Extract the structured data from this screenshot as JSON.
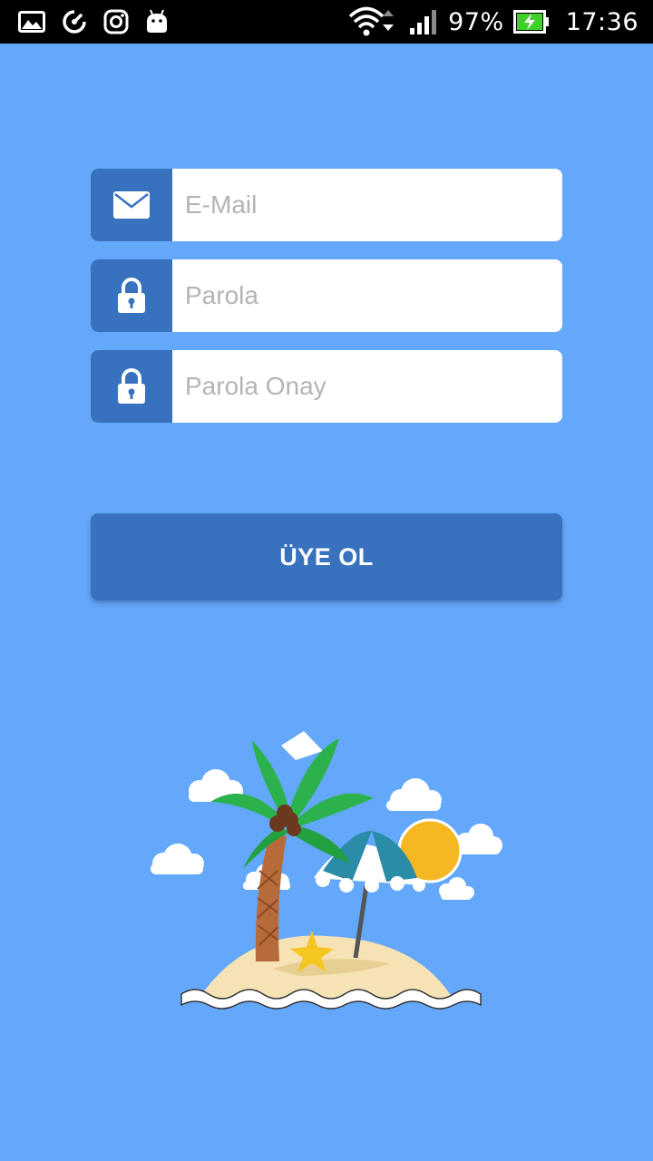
{
  "status_bar": {
    "battery_percent": "97%",
    "time": "17:36",
    "icons": [
      "gallery-icon",
      "speed-icon",
      "instagram-icon",
      "android-icon",
      "wifi-icon",
      "signal-icon",
      "battery-charging-icon"
    ]
  },
  "form": {
    "email": {
      "placeholder": "E-Mail",
      "icon": "mail-icon"
    },
    "password": {
      "placeholder": "Parola",
      "icon": "lock-icon"
    },
    "password_confirm": {
      "placeholder": "Parola Onay",
      "icon": "lock-icon"
    },
    "submit_label": "ÜYE OL"
  },
  "colors": {
    "background": "#64a8fc",
    "accent": "#3872be",
    "field_bg": "#ffffff",
    "battery": "#3fd12a"
  },
  "illustration": "beach-island-illustration"
}
